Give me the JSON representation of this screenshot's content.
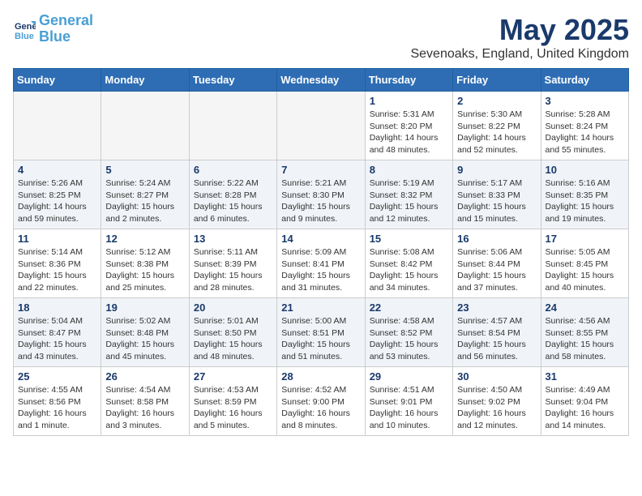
{
  "header": {
    "logo_line1": "General",
    "logo_line2": "Blue",
    "month": "May 2025",
    "location": "Sevenoaks, England, United Kingdom"
  },
  "weekdays": [
    "Sunday",
    "Monday",
    "Tuesday",
    "Wednesday",
    "Thursday",
    "Friday",
    "Saturday"
  ],
  "weeks": [
    [
      {
        "day": "",
        "info": ""
      },
      {
        "day": "",
        "info": ""
      },
      {
        "day": "",
        "info": ""
      },
      {
        "day": "",
        "info": ""
      },
      {
        "day": "1",
        "info": "Sunrise: 5:31 AM\nSunset: 8:20 PM\nDaylight: 14 hours\nand 48 minutes."
      },
      {
        "day": "2",
        "info": "Sunrise: 5:30 AM\nSunset: 8:22 PM\nDaylight: 14 hours\nand 52 minutes."
      },
      {
        "day": "3",
        "info": "Sunrise: 5:28 AM\nSunset: 8:24 PM\nDaylight: 14 hours\nand 55 minutes."
      }
    ],
    [
      {
        "day": "4",
        "info": "Sunrise: 5:26 AM\nSunset: 8:25 PM\nDaylight: 14 hours\nand 59 minutes."
      },
      {
        "day": "5",
        "info": "Sunrise: 5:24 AM\nSunset: 8:27 PM\nDaylight: 15 hours\nand 2 minutes."
      },
      {
        "day": "6",
        "info": "Sunrise: 5:22 AM\nSunset: 8:28 PM\nDaylight: 15 hours\nand 6 minutes."
      },
      {
        "day": "7",
        "info": "Sunrise: 5:21 AM\nSunset: 8:30 PM\nDaylight: 15 hours\nand 9 minutes."
      },
      {
        "day": "8",
        "info": "Sunrise: 5:19 AM\nSunset: 8:32 PM\nDaylight: 15 hours\nand 12 minutes."
      },
      {
        "day": "9",
        "info": "Sunrise: 5:17 AM\nSunset: 8:33 PM\nDaylight: 15 hours\nand 15 minutes."
      },
      {
        "day": "10",
        "info": "Sunrise: 5:16 AM\nSunset: 8:35 PM\nDaylight: 15 hours\nand 19 minutes."
      }
    ],
    [
      {
        "day": "11",
        "info": "Sunrise: 5:14 AM\nSunset: 8:36 PM\nDaylight: 15 hours\nand 22 minutes."
      },
      {
        "day": "12",
        "info": "Sunrise: 5:12 AM\nSunset: 8:38 PM\nDaylight: 15 hours\nand 25 minutes."
      },
      {
        "day": "13",
        "info": "Sunrise: 5:11 AM\nSunset: 8:39 PM\nDaylight: 15 hours\nand 28 minutes."
      },
      {
        "day": "14",
        "info": "Sunrise: 5:09 AM\nSunset: 8:41 PM\nDaylight: 15 hours\nand 31 minutes."
      },
      {
        "day": "15",
        "info": "Sunrise: 5:08 AM\nSunset: 8:42 PM\nDaylight: 15 hours\nand 34 minutes."
      },
      {
        "day": "16",
        "info": "Sunrise: 5:06 AM\nSunset: 8:44 PM\nDaylight: 15 hours\nand 37 minutes."
      },
      {
        "day": "17",
        "info": "Sunrise: 5:05 AM\nSunset: 8:45 PM\nDaylight: 15 hours\nand 40 minutes."
      }
    ],
    [
      {
        "day": "18",
        "info": "Sunrise: 5:04 AM\nSunset: 8:47 PM\nDaylight: 15 hours\nand 43 minutes."
      },
      {
        "day": "19",
        "info": "Sunrise: 5:02 AM\nSunset: 8:48 PM\nDaylight: 15 hours\nand 45 minutes."
      },
      {
        "day": "20",
        "info": "Sunrise: 5:01 AM\nSunset: 8:50 PM\nDaylight: 15 hours\nand 48 minutes."
      },
      {
        "day": "21",
        "info": "Sunrise: 5:00 AM\nSunset: 8:51 PM\nDaylight: 15 hours\nand 51 minutes."
      },
      {
        "day": "22",
        "info": "Sunrise: 4:58 AM\nSunset: 8:52 PM\nDaylight: 15 hours\nand 53 minutes."
      },
      {
        "day": "23",
        "info": "Sunrise: 4:57 AM\nSunset: 8:54 PM\nDaylight: 15 hours\nand 56 minutes."
      },
      {
        "day": "24",
        "info": "Sunrise: 4:56 AM\nSunset: 8:55 PM\nDaylight: 15 hours\nand 58 minutes."
      }
    ],
    [
      {
        "day": "25",
        "info": "Sunrise: 4:55 AM\nSunset: 8:56 PM\nDaylight: 16 hours\nand 1 minute."
      },
      {
        "day": "26",
        "info": "Sunrise: 4:54 AM\nSunset: 8:58 PM\nDaylight: 16 hours\nand 3 minutes."
      },
      {
        "day": "27",
        "info": "Sunrise: 4:53 AM\nSunset: 8:59 PM\nDaylight: 16 hours\nand 5 minutes."
      },
      {
        "day": "28",
        "info": "Sunrise: 4:52 AM\nSunset: 9:00 PM\nDaylight: 16 hours\nand 8 minutes."
      },
      {
        "day": "29",
        "info": "Sunrise: 4:51 AM\nSunset: 9:01 PM\nDaylight: 16 hours\nand 10 minutes."
      },
      {
        "day": "30",
        "info": "Sunrise: 4:50 AM\nSunset: 9:02 PM\nDaylight: 16 hours\nand 12 minutes."
      },
      {
        "day": "31",
        "info": "Sunrise: 4:49 AM\nSunset: 9:04 PM\nDaylight: 16 hours\nand 14 minutes."
      }
    ]
  ]
}
